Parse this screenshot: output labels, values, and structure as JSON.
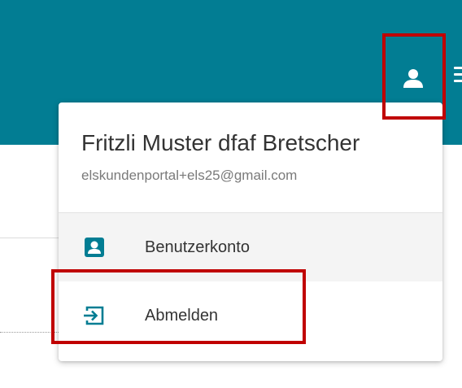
{
  "colors": {
    "header_bg": "#027d93",
    "accent": "#027d93",
    "highlight": "#c00000"
  },
  "header": {
    "user_icon": "person-icon",
    "menu_icon": "hamburger-menu-icon"
  },
  "dropdown": {
    "user_name": "Fritzli Muster dfaf Bretscher",
    "user_email": "elskundenportal+els25@gmail.com",
    "items": [
      {
        "label": "Benutzerkonto",
        "icon": "account-card-icon"
      },
      {
        "label": "Abmelden",
        "icon": "logout-icon"
      }
    ]
  }
}
